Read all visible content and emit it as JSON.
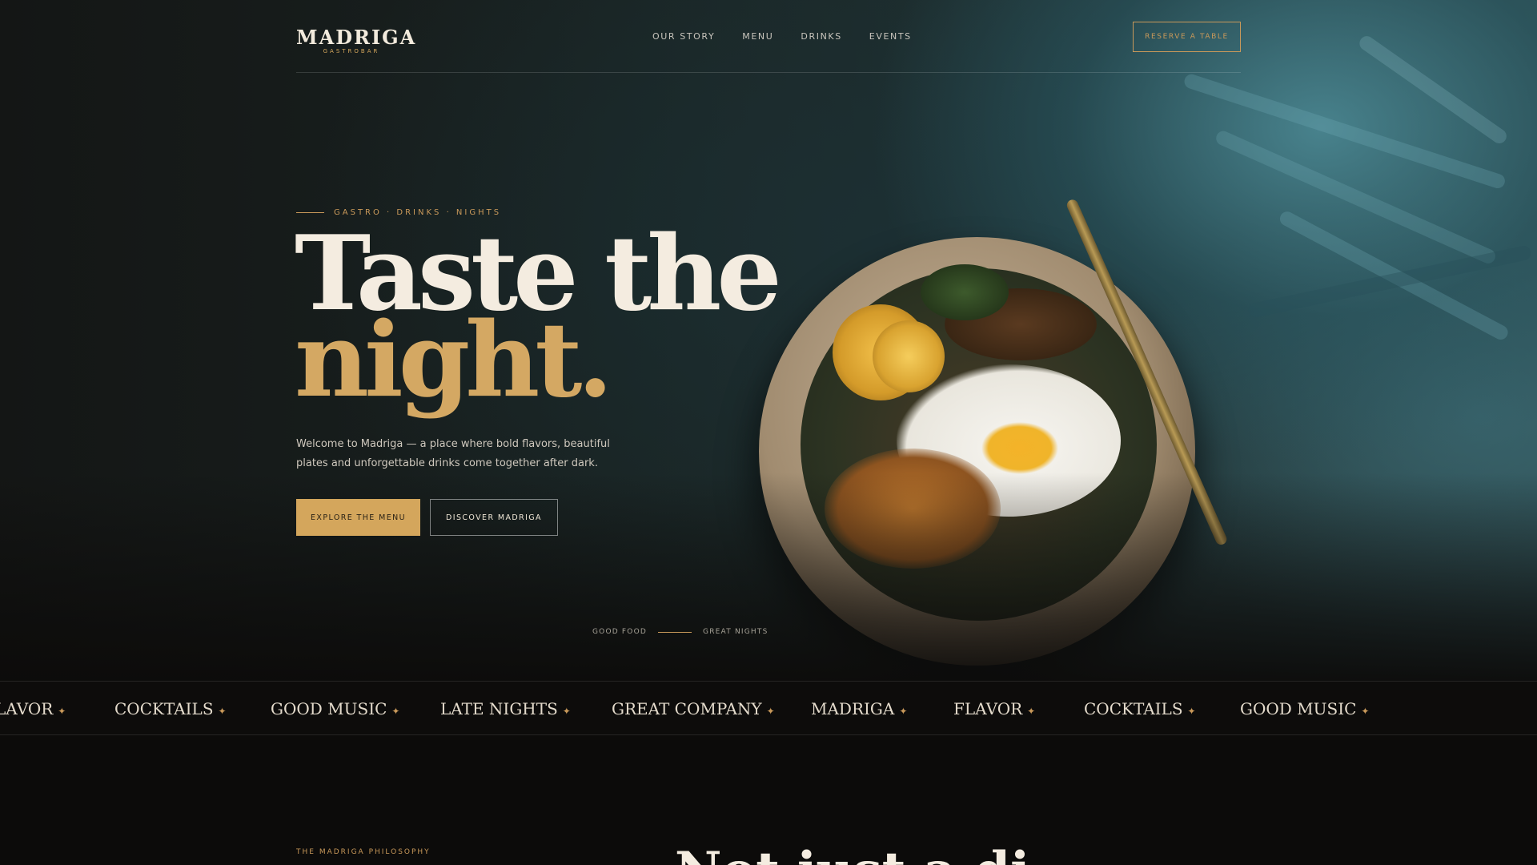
{
  "header": {
    "logo": "MADRIGA",
    "logo_sub": "GASTROBAR",
    "nav": [
      "OUR STORY",
      "MENU",
      "DRINKS",
      "EVENTS"
    ],
    "reserve": "RESERVE A TABLE"
  },
  "hero": {
    "eyebrow": "GASTRO · DRINKS · NIGHTS",
    "headline_line1": "Taste the",
    "headline_line2": "night.",
    "lede": "Welcome to Madriga — a place where bold flavors, beautiful plates and unforgettable drinks come together after dark.",
    "primary_cta": "EXPLORE THE MENU",
    "secondary_cta": "DISCOVER MADRIGA",
    "tag_left": "GOOD FOOD",
    "tag_right": "GREAT NIGHTS"
  },
  "marquee": {
    "items": [
      "LAVOR",
      "COCKTAILS",
      "GOOD MUSIC",
      "LATE NIGHTS",
      "GREAT COMPANY",
      "MADRIGA",
      "FLAVOR",
      "COCKTAILS",
      "GOOD MUSIC"
    ],
    "separator": "✦"
  },
  "philosophy": {
    "eyebrow": "THE MADRIGA PHILOSOPHY",
    "title": "Not just a di"
  },
  "colors": {
    "accent": "#d4a65c",
    "background": "#0c0b0a",
    "teal": "#4a8691"
  }
}
